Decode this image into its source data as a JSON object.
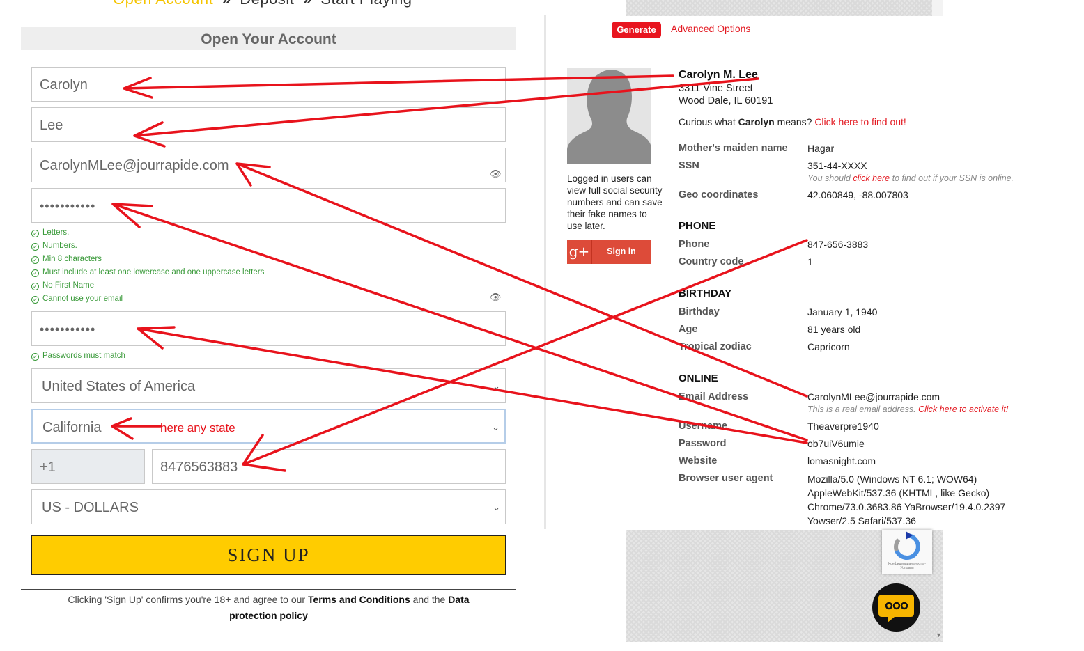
{
  "signup": {
    "steps": {
      "step1": "Open Account",
      "sep": "»",
      "step2": "Deposit",
      "step3": "Start Playing"
    },
    "title": "Open Your Account",
    "first_name": "Carolyn",
    "last_name": "Lee",
    "email": "CarolynMLee@jourrapide.com",
    "password_mask": "•••••••••••",
    "password_hints": [
      "Letters.",
      "Numbers.",
      "Min 8 characters",
      "Must include at least one lowercase and one uppercase letters",
      "No First Name",
      "Cannot use your email"
    ],
    "confirm_mask": "•••••••••••",
    "match_hint": "Passwords must match",
    "country": "United States of America",
    "state": "California",
    "annotation": "here any state",
    "phone_prefix": "+1",
    "phone": "8476563883",
    "currency": "US - DOLLARS",
    "signup_label": "SIGN UP",
    "terms_pre": "Clicking 'Sign Up' confirms you're 18+ and agree to our ",
    "terms_link": "Terms and Conditions",
    "terms_mid": " and the ",
    "privacy_link_1": "Data",
    "privacy_link_2": "protection policy"
  },
  "identity": {
    "generate_label": "Generate",
    "advanced_label": "Advanced Options",
    "login_note": "Logged in users can view full social security numbers and can save their fake names to use later.",
    "gplus_glyph": "g+",
    "gplus_label": "Sign in",
    "name": "Carolyn M. Lee",
    "street": "3311 Vine Street",
    "city": "Wood Dale, IL 60191",
    "curious_pre": "Curious what ",
    "curious_name": "Carolyn",
    "curious_mid": " means? ",
    "curious_link": "Click here to find out!",
    "basic": {
      "maiden_label": "Mother's maiden name",
      "maiden": "Hagar",
      "ssn_label": "SSN",
      "ssn": "351-44-XXXX",
      "ssn_note_pre": "You should ",
      "ssn_note_link": "click here",
      "ssn_note_post": " to find out if your SSN is online.",
      "geo_label": "Geo coordinates",
      "geo": "42.060849, -88.007803"
    },
    "phone_section": {
      "title": "PHONE",
      "phone_label": "Phone",
      "phone": "847-656-3883",
      "cc_label": "Country code",
      "cc": "1"
    },
    "birthday_section": {
      "title": "BIRTHDAY",
      "bday_label": "Birthday",
      "bday": "January 1, 1940",
      "age_label": "Age",
      "age": "81 years old",
      "zodiac_label": "Tropical zodiac",
      "zodiac": "Capricorn"
    },
    "online_section": {
      "title": "ONLINE",
      "email_label": "Email Address",
      "email": "CarolynMLee@jourrapide.com",
      "email_note": "This is a real email address. ",
      "email_note_link": "Click here to activate it!",
      "user_label": "Username",
      "user": "Theaverpre1940",
      "pass_label": "Password",
      "pass": "ob7uiV6umie",
      "web_label": "Website",
      "web": "lomasnight.com",
      "ua_label": "Browser user agent",
      "ua_lines": [
        "Mozilla/5.0 (Windows NT 6.1; WOW64)",
        "AppleWebKit/537.36 (KHTML, like Gecko)",
        "Chrome/73.0.3683.86 YaBrowser/19.4.0.2397",
        "Yowser/2.5 Safari/537.36"
      ]
    },
    "recaptcha_caption": "Конфиденциальность - Условия"
  },
  "colors": {
    "arrow": "#e8131c",
    "accent": "#ffcc00",
    "brand_red": "#e31b23",
    "hint_green": "#3a9a3a"
  }
}
